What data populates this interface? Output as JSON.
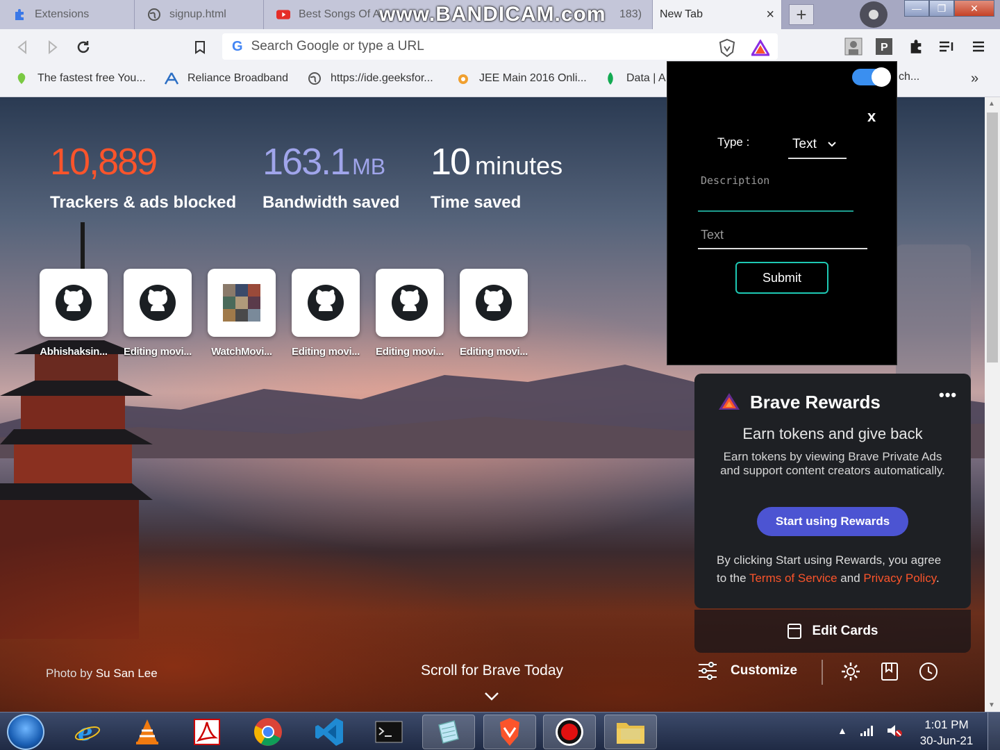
{
  "tabs": [
    {
      "label": "Extensions",
      "icon": "puzzle-icon"
    },
    {
      "label": "signup.html",
      "icon": "globe-icon"
    },
    {
      "label": "Best Songs Of A",
      "icon": "youtube-icon"
    },
    {
      "label": "New Tab",
      "icon": "none",
      "active": true
    }
  ],
  "watermark": "www.BANDICAM.com",
  "watermark_tail": "183)",
  "tab_close": "×",
  "new_tab_button": "+",
  "window_controls": {
    "minimize": "—",
    "restore": "❐",
    "close": "✕"
  },
  "omnibox": {
    "placeholder": "Search Google or type a URL",
    "engine_icon": "G"
  },
  "bookmarks": [
    {
      "label": "The fastest free You...",
      "icon": "leaf-icon"
    },
    {
      "label": "Reliance Broadband",
      "icon": "reliance-icon"
    },
    {
      "label": "https://ide.geeksfor...",
      "icon": "globe-icon"
    },
    {
      "label": "JEE Main 2016 Onli...",
      "icon": "jee-icon"
    },
    {
      "label": "Data | A",
      "icon": "data-icon"
    }
  ],
  "bookmarks_hidden_tail": "ch...",
  "bookmarks_more": "»",
  "stats": {
    "trackers": {
      "value": "10,889",
      "label": "Trackers & ads blocked",
      "color": "#fb542b"
    },
    "bandwidth": {
      "value": "163.1",
      "unit": "MB",
      "label": "Bandwidth saved",
      "color": "#a0a5eb"
    },
    "time": {
      "value": "10",
      "unit": "minutes",
      "label": "Time saved",
      "color": "#ffffff"
    }
  },
  "top_sites": [
    {
      "label": "Abhishaksin...",
      "icon": "github-icon"
    },
    {
      "label": "Editing movi...",
      "icon": "github-icon"
    },
    {
      "label": "WatchMovi...",
      "icon": "mosaic-icon"
    },
    {
      "label": "Editing movi...",
      "icon": "github-icon"
    },
    {
      "label": "Editing movi...",
      "icon": "github-icon"
    },
    {
      "label": "Editing movi...",
      "icon": "github-icon"
    }
  ],
  "extension_popup": {
    "close": "x",
    "type_label": "Type :",
    "type_value": "Text",
    "description_placeholder": "Description",
    "text_placeholder": "Text",
    "submit": "Submit",
    "toggle_on": true
  },
  "rewards": {
    "title": "Brave Rewards",
    "more": "•••",
    "subtitle": "Earn tokens and give back",
    "description": "Earn tokens by viewing Brave Private Ads and support content creators automatically.",
    "button": "Start using Rewards",
    "legal_prefix": "By clicking Start using Rewards, you agree to the",
    "terms": "Terms of Service",
    "and": "and",
    "privacy": "Privacy Policy",
    "period": ".",
    "edit_cards": "Edit Cards"
  },
  "footer": {
    "photo_prefix": "Photo by",
    "photographer": "Su San Lee",
    "scroll_text": "Scroll for Brave Today",
    "customize": "Customize"
  },
  "taskbar": {
    "apps": [
      "start-orb",
      "internet-explorer-icon",
      "vlc-icon",
      "acrobat-icon",
      "chrome-icon",
      "vscode-icon",
      "cmd-icon",
      "notepad-icon",
      "brave-icon",
      "bandicam-record-icon",
      "explorer-icon"
    ],
    "time": "1:01 PM",
    "date": "30-Jun-21"
  },
  "colors": {
    "brave_orange": "#fb542b",
    "rewards_button": "#4c54d2",
    "submit_border": "#1ec9b4",
    "toggle": "#3a8ff0"
  }
}
